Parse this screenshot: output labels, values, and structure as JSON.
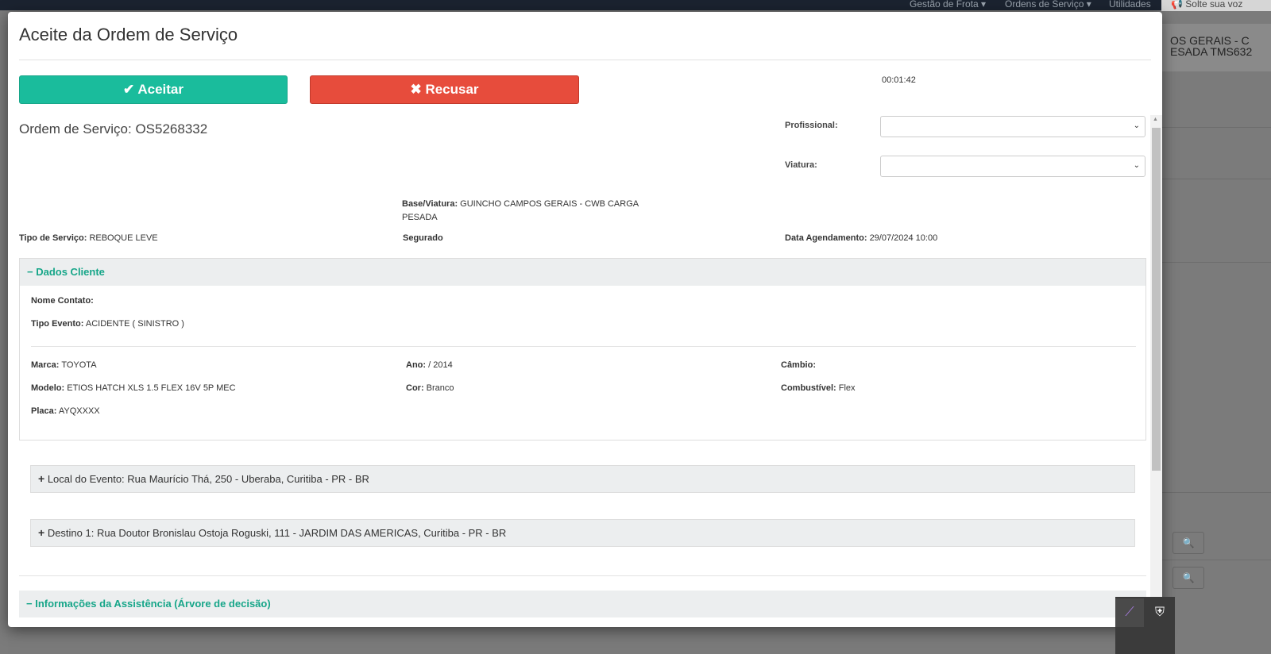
{
  "background": {
    "nav": [
      "Gestão de Frota ▾",
      "Ordens de Serviço ▾",
      "Utilidades"
    ],
    "voice_button": "Solte sua voz",
    "right_text_line1": "OS GERAIS - C",
    "right_text_line2": "ESADA TMS632"
  },
  "modal": {
    "title": "Aceite da Ordem de Serviço",
    "accept_label": "Aceitar",
    "reject_label": "Recusar",
    "timer": "00:01:42",
    "order": "Ordem de Serviço: OS5268332",
    "profissional_label": "Profissional:",
    "profissional_value": "",
    "viatura_label": "Viatura:",
    "viatura_value": "",
    "base_label": "Base/Viatura:",
    "base_value": "GUINCHO CAMPOS GERAIS - CWB CARGA PESADA",
    "tipo_servico_label": "Tipo de Serviço:",
    "tipo_servico_value": "REBOQUE LEVE",
    "segurado_label": "Segurado",
    "data_label": "Data Agendamento:",
    "data_value": "29/07/2024 10:00",
    "cliente": {
      "title": "Dados Cliente",
      "nome_label": "Nome Contato:",
      "nome_value": "",
      "evento_label": "Tipo Evento:",
      "evento_value": "ACIDENTE ( SINISTRO )",
      "marca_label": "Marca:",
      "marca_value": "TOYOTA",
      "modelo_label": "Modelo:",
      "modelo_value": "ETIOS HATCH XLS 1.5 FLEX 16V 5P MEC",
      "placa_label": "Placa:",
      "placa_value": "AYQXXXX",
      "ano_label": "Ano:",
      "ano_value": "/ 2014",
      "cor_label": "Cor:",
      "cor_value": "Branco",
      "cambio_label": "Câmbio:",
      "cambio_value": "",
      "combustivel_label": "Combustível:",
      "combustivel_value": "Flex"
    },
    "local_evento": "Local do Evento: Rua Maurício Thá, 250 - Uberaba, Curitiba - PR - BR",
    "destino": "Destino 1: Rua Doutor Bronislau Ostoja Roguski, 111 - JARDIM DAS AMERICAS, Curitiba - PR - BR",
    "assistencia_title": "Informações da Assistência (Árvore de decisão)"
  },
  "colors": {
    "accept": "#1abc9c",
    "reject": "#e74c3c",
    "accent_text": "#17a689"
  }
}
